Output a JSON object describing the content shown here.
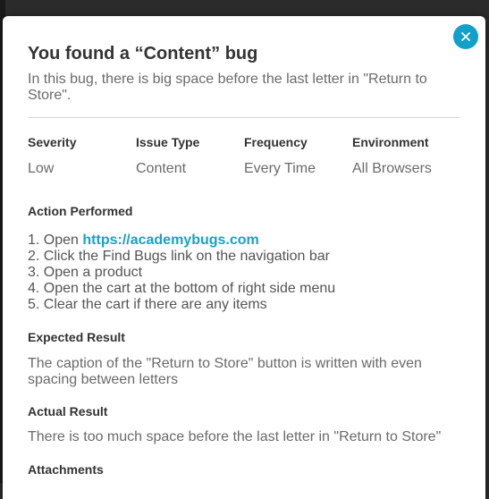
{
  "modal": {
    "title": "You found a “Content” bug",
    "subtitle": "In this bug, there is big space before the last letter in \"Return to Store\".",
    "close_icon": "close-icon"
  },
  "meta": [
    {
      "label": "Severity",
      "value": "Low"
    },
    {
      "label": "Issue Type",
      "value": "Content"
    },
    {
      "label": "Frequency",
      "value": "Every Time"
    },
    {
      "label": "Environment",
      "value": "All Browsers"
    }
  ],
  "action": {
    "heading": "Action Performed",
    "steps": [
      {
        "num": "1.",
        "prefix": "Open ",
        "link": "https://academybugs.com"
      },
      {
        "num": "2.",
        "text": "Click the Find Bugs link on the navigation bar"
      },
      {
        "num": "3.",
        "text": "Open a product"
      },
      {
        "num": "4.",
        "text": "Open the cart at the bottom of right side menu"
      },
      {
        "num": "5.",
        "text": "Clear the cart if there are any items"
      }
    ]
  },
  "expected": {
    "heading": "Expected Result",
    "text": "The caption of the \"Return to Store\" button is written with even spacing between letters"
  },
  "actual": {
    "heading": "Actual Result",
    "text": "There is too much space before the last letter in \"Return to Store\""
  },
  "attachments": {
    "heading": "Attachments"
  },
  "colors": {
    "accent": "#11a0c8",
    "link": "#17a2c6",
    "heading": "#333333",
    "body_text": "#6a6a6a"
  }
}
